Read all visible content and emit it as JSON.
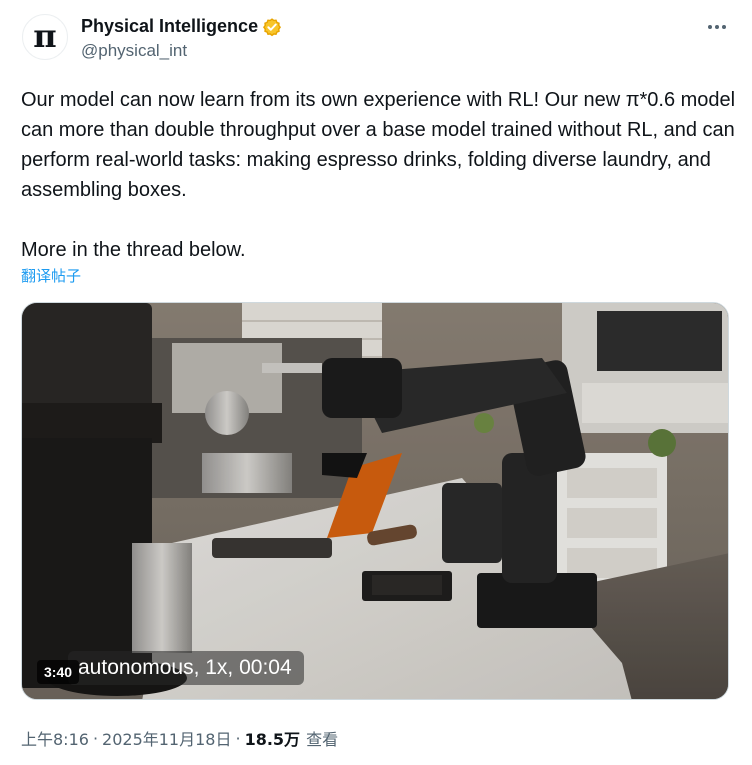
{
  "author": {
    "avatar_glyph": "π",
    "name": "Physical Intelligence",
    "handle": "@physical_int",
    "verified_badge_color": "#f4b400"
  },
  "post": {
    "paragraphs": [
      "Our model can now learn from its own experience with RL! Our new π*0.6 model can more than double throughput over a base model trained without RL, and can perform real-world tasks: making espresso drinks, folding diverse laundry, and assembling boxes.",
      "More in the thread below."
    ],
    "translate_label": "翻译帖子"
  },
  "video": {
    "caption": "autonomous, 1x, 00:04",
    "duration": "3:40"
  },
  "meta": {
    "time": "上午8:16",
    "separator": "·",
    "date": "2025年11月18日",
    "views_count": "18.5万",
    "views_label": "查看"
  },
  "colors": {
    "text": "#0f1419",
    "secondary": "#536471",
    "link": "#1d9bf0"
  },
  "icons": {
    "more": "more-horizontal-icon",
    "verified": "verified-badge-icon"
  }
}
